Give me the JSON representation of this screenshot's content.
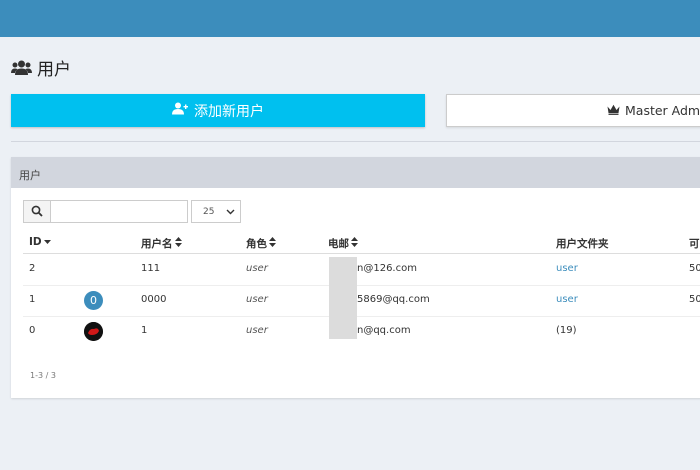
{
  "page": {
    "title": "用户"
  },
  "actions": {
    "add_user_label": "添加新用户",
    "master_admin_label": "Master Admin"
  },
  "panel": {
    "title": "用户"
  },
  "search": {
    "value": "",
    "placeholder": ""
  },
  "page_size": {
    "selected": "25"
  },
  "table": {
    "columns": [
      {
        "label": "ID",
        "sort": "desc"
      },
      {
        "label": "",
        "sort": ""
      },
      {
        "label": "用户名",
        "sort": "both"
      },
      {
        "label": "角色",
        "sort": "both"
      },
      {
        "label": "电邮",
        "sort": "both"
      },
      {
        "label": "用户文件夹",
        "sort": ""
      },
      {
        "label": "可",
        "sort": ""
      }
    ],
    "rows": [
      {
        "id": "2",
        "avatar": {
          "type": "none",
          "text": ""
        },
        "username": "111",
        "role": "user",
        "email": "n@126.com",
        "folder": "user",
        "extra": "50"
      },
      {
        "id": "1",
        "avatar": {
          "type": "badge",
          "text": "0"
        },
        "username": "0000",
        "role": "user",
        "email": "5869@qq.com",
        "folder": "user",
        "extra": "50"
      },
      {
        "id": "0",
        "avatar": {
          "type": "image",
          "text": ""
        },
        "username": "1",
        "role": "user",
        "email": "n@qq.com",
        "folder": "(19)",
        "extra": ""
      }
    ]
  },
  "pagination": {
    "count_text": "1-3 / 3"
  },
  "colors": {
    "topbar": "#3c8dbc",
    "add_button": "#00c0ef",
    "link": "#3c8dbc",
    "panel_header": "#d2d6de",
    "background": "#ecf0f5"
  },
  "icons": {
    "title": "users-icon",
    "add_button": "user-plus-icon",
    "master_admin": "crown-icon",
    "search": "search-icon",
    "page_size": "chevron-down-icon",
    "sort_desc": "sort-desc-icon",
    "sort_both": "sort-icon"
  }
}
